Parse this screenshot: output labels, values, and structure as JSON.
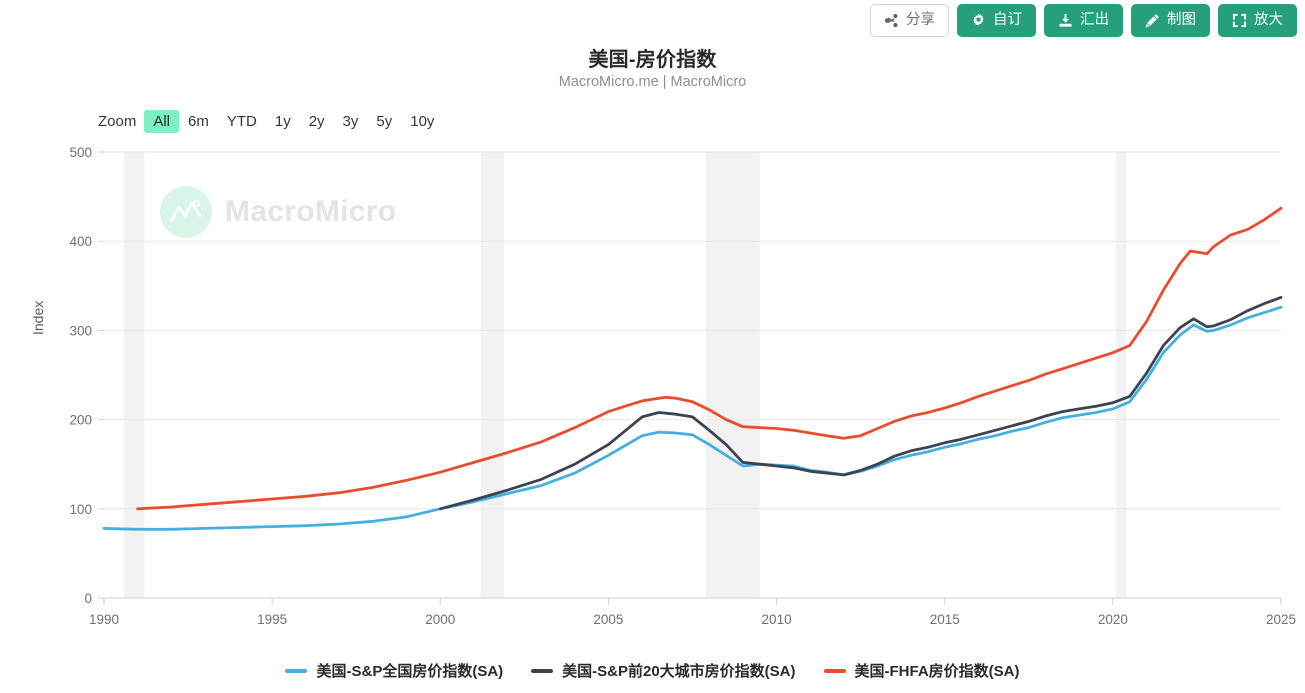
{
  "toolbar": {
    "buttons": [
      {
        "label": "分享",
        "icon": "share-icon",
        "style": "ghost"
      },
      {
        "label": "自订",
        "icon": "gear-icon",
        "style": "solid"
      },
      {
        "label": "汇出",
        "icon": "download-icon",
        "style": "solid"
      },
      {
        "label": "制图",
        "icon": "pencil-icon",
        "style": "solid"
      },
      {
        "label": "放大",
        "icon": "expand-icon",
        "style": "solid"
      }
    ]
  },
  "header": {
    "title": "美国-房价指数",
    "subtitle": "MacroMicro.me | MacroMicro"
  },
  "zoom_selector": {
    "label": "Zoom",
    "options": [
      "All",
      "6m",
      "YTD",
      "1y",
      "2y",
      "3y",
      "5y",
      "10y"
    ],
    "selected": "All"
  },
  "watermark": {
    "text": "MacroMicro",
    "icon": "macromicro-logo-icon"
  },
  "colors": {
    "accent_green": "#26a07a",
    "zoom_active": "#7cefc3",
    "series_blue": "#45b0e0",
    "series_dark": "#3a4453",
    "series_red": "#ea4c30",
    "gridline": "#e8e8e8",
    "recession_band": "#f2f2f2"
  },
  "chart_data": {
    "type": "line",
    "title": "美国-房价指数",
    "subtitle": "MacroMicro.me | MacroMicro",
    "xlabel": "",
    "ylabel": "Index",
    "xlim": [
      1990,
      2025
    ],
    "ylim": [
      0,
      500
    ],
    "yticks": [
      0,
      100,
      200,
      300,
      400,
      500
    ],
    "xticks": [
      1990,
      1995,
      2000,
      2005,
      2010,
      2015,
      2020,
      2025
    ],
    "grid": true,
    "legend_position": "bottom",
    "recession_bands": [
      {
        "start": 1990.6,
        "end": 1991.2
      },
      {
        "start": 2001.2,
        "end": 2001.9
      },
      {
        "start": 2007.9,
        "end": 2009.5
      },
      {
        "start": 2020.1,
        "end": 2020.4
      }
    ],
    "series": [
      {
        "name": "美国-S&P全国房价指数(SA)",
        "color": "#45b0e0",
        "x": [
          1990,
          1991,
          1992,
          1993,
          1994,
          1995,
          1996,
          1997,
          1998,
          1999,
          2000,
          2001,
          2002,
          2003,
          2004,
          2005,
          2006,
          2006.5,
          2007,
          2007.5,
          2008,
          2008.5,
          2009,
          2009.5,
          2010,
          2010.5,
          2011,
          2011.5,
          2012,
          2012.5,
          2013,
          2013.5,
          2014,
          2014.5,
          2015,
          2015.5,
          2016,
          2016.5,
          2017,
          2017.5,
          2018,
          2018.5,
          2019,
          2019.5,
          2020,
          2020.5,
          2021,
          2021.5,
          2022,
          2022.4,
          2022.8,
          2023,
          2023.5,
          2024,
          2024.5,
          2025
        ],
        "values": [
          78,
          77,
          77,
          78,
          79,
          80,
          81,
          83,
          86,
          91,
          100,
          108,
          117,
          126,
          140,
          160,
          182,
          186,
          185,
          183,
          172,
          160,
          148,
          150,
          149,
          148,
          143,
          141,
          138,
          142,
          148,
          155,
          160,
          164,
          169,
          173,
          178,
          182,
          187,
          191,
          197,
          202,
          205,
          208,
          212,
          220,
          245,
          275,
          295,
          306,
          299,
          300,
          306,
          314,
          320,
          326
        ]
      },
      {
        "name": "美国-S&P前20大城市房价指数(SA)",
        "color": "#3a4453",
        "x": [
          2000,
          2001,
          2002,
          2003,
          2004,
          2005,
          2006,
          2006.5,
          2007,
          2007.5,
          2008,
          2008.5,
          2009,
          2009.5,
          2010,
          2010.5,
          2011,
          2011.5,
          2012,
          2012.5,
          2013,
          2013.5,
          2014,
          2014.5,
          2015,
          2015.5,
          2016,
          2016.5,
          2017,
          2017.5,
          2018,
          2018.5,
          2019,
          2019.5,
          2020,
          2020.5,
          2021,
          2021.5,
          2022,
          2022.4,
          2022.8,
          2023,
          2023.5,
          2024,
          2024.5,
          2025
        ],
        "values": [
          100,
          110,
          121,
          133,
          150,
          172,
          203,
          208,
          206,
          203,
          188,
          172,
          152,
          150,
          148,
          146,
          142,
          140,
          138,
          143,
          150,
          159,
          165,
          169,
          174,
          178,
          183,
          188,
          193,
          198,
          204,
          209,
          212,
          215,
          219,
          226,
          252,
          283,
          303,
          313,
          304,
          305,
          312,
          322,
          330,
          337
        ]
      },
      {
        "name": "美国-FHFA房价指数(SA)",
        "color": "#ea4c30",
        "x": [
          1991,
          1992,
          1993,
          1994,
          1995,
          1996,
          1997,
          1998,
          1999,
          2000,
          2001,
          2002,
          2003,
          2004,
          2005,
          2006,
          2006.7,
          2007,
          2007.5,
          2008,
          2008.5,
          2009,
          2009.5,
          2010,
          2010.5,
          2011,
          2011.5,
          2012,
          2012.5,
          2013,
          2013.5,
          2014,
          2014.5,
          2015,
          2015.5,
          2016,
          2016.5,
          2017,
          2017.5,
          2018,
          2018.5,
          2019,
          2019.5,
          2020,
          2020.5,
          2021,
          2021.5,
          2022,
          2022.3,
          2022.8,
          2023,
          2023.5,
          2024,
          2024.5,
          2025
        ],
        "values": [
          100,
          102,
          105,
          108,
          111,
          114,
          118,
          124,
          132,
          141,
          152,
          163,
          175,
          191,
          209,
          221,
          225,
          224,
          220,
          211,
          200,
          192,
          191,
          190,
          188,
          185,
          182,
          179,
          182,
          190,
          198,
          204,
          208,
          213,
          219,
          226,
          232,
          238,
          244,
          251,
          257,
          263,
          269,
          275,
          283,
          310,
          345,
          375,
          389,
          386,
          394,
          407,
          413,
          424,
          437
        ]
      }
    ]
  }
}
